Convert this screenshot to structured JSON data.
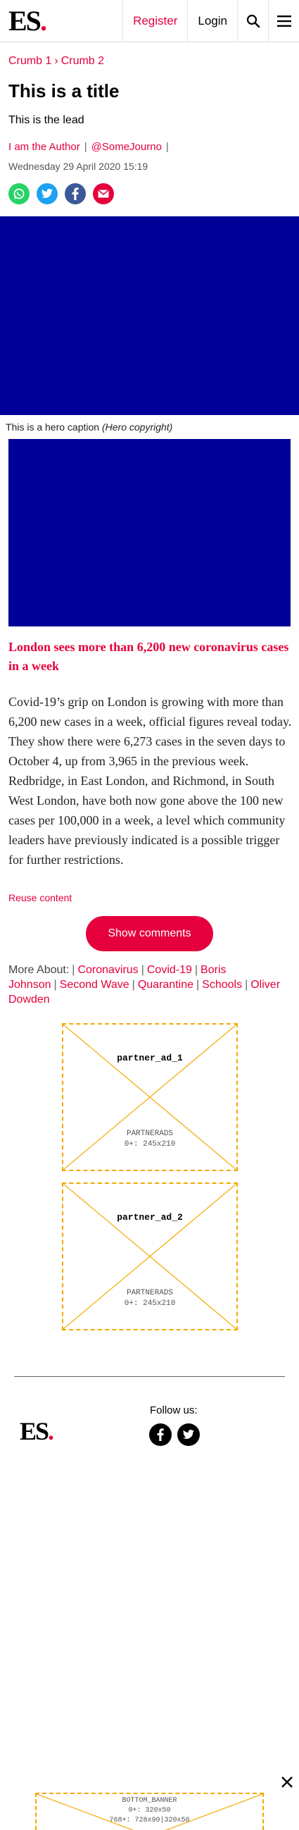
{
  "header": {
    "logo_text": "ES",
    "logo_dot": ".",
    "register_label": "Register",
    "login_label": "Login",
    "search_icon": "search-icon",
    "menu_icon": "hamburger-menu-icon"
  },
  "breadcrumb": {
    "items": [
      "Crumb 1",
      "Crumb 2"
    ],
    "separator": "›"
  },
  "article": {
    "title": "This is a title",
    "lead": "This is the lead",
    "author": "I am the Author",
    "handle": "@SomeJourno",
    "separator": "|",
    "date": "Wednesday 29 April 2020 15:19",
    "hero_caption": "This is a hero caption",
    "hero_copyright": "(Hero copyright)",
    "subheading": "London sees more than 6,200 new coronavirus cases in a week",
    "body": "Covid-19’s grip on London is growing with more than 6,200 new cases in a week, official figures reveal today. They show there were 6,273 cases in the seven days to October 4, up from 3,965 in the previous week. Redbridge, in East London, and Richmond, in South West London, have both now gone above the 100 new cases per 100,000 in a week, a level which community leaders have previously indicated is a possible trigger for further restrictions.",
    "reuse_label": "Reuse content",
    "show_comments_label": "Show comments"
  },
  "share": {
    "icons": [
      "whatsapp-icon",
      "twitter-icon",
      "facebook-icon",
      "email-icon"
    ],
    "colors": [
      "#25d366",
      "#1da1f2",
      "#3b5998",
      "#e5003d"
    ]
  },
  "more_about": {
    "label": "More About:",
    "topics": [
      "Coronavirus",
      "Covid-19",
      "Boris Johnson",
      "Second Wave",
      "Quarantine",
      "Schools",
      "Oliver Dowden"
    ]
  },
  "ads": [
    {
      "name": "partner_ad_1",
      "provider": "PARTNERADS",
      "size": "0+: 245x210"
    },
    {
      "name": "partner_ad_2",
      "provider": "PARTNERADS",
      "size": "0+: 245x210"
    }
  ],
  "footer": {
    "logo_text": "ES",
    "logo_dot": ".",
    "follow_label": "Follow us:",
    "social_icons": [
      "facebook-icon",
      "twitter-icon"
    ]
  },
  "bottom_banner": {
    "name": "BOTTOM_BANNER",
    "size_small": "0+: 320x50",
    "size_large": "768+: 728x90|320x50",
    "close_icon": "close-icon"
  },
  "colors": {
    "accent": "#e5003d",
    "hero_blue": "#010098",
    "ad_border": "#f5a800"
  }
}
